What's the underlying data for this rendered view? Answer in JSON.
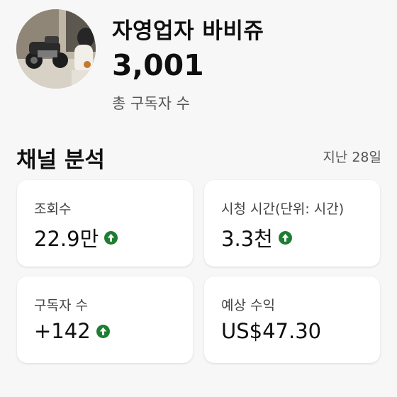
{
  "channel": {
    "name": "자영업자 바비쥬",
    "subscriber_count": "3,001",
    "subscriber_label": "총 구독자 수"
  },
  "analytics": {
    "title": "채널 분석",
    "period": "지난 28일",
    "cards": [
      {
        "label": "조회수",
        "value": "22.9만",
        "trend": "up"
      },
      {
        "label": "시청 시간(단위: 시간)",
        "value": "3.3천",
        "trend": "up"
      },
      {
        "label": "구독자 수",
        "value": "+142",
        "trend": "up"
      },
      {
        "label": "예상 수익",
        "value": "US$47.30",
        "trend": "none"
      }
    ]
  },
  "colors": {
    "trend_up": "#1e7d32",
    "background": "#f7f7f7",
    "card": "#ffffff"
  },
  "icons": {
    "trend": "arrow-up-circle-icon"
  }
}
